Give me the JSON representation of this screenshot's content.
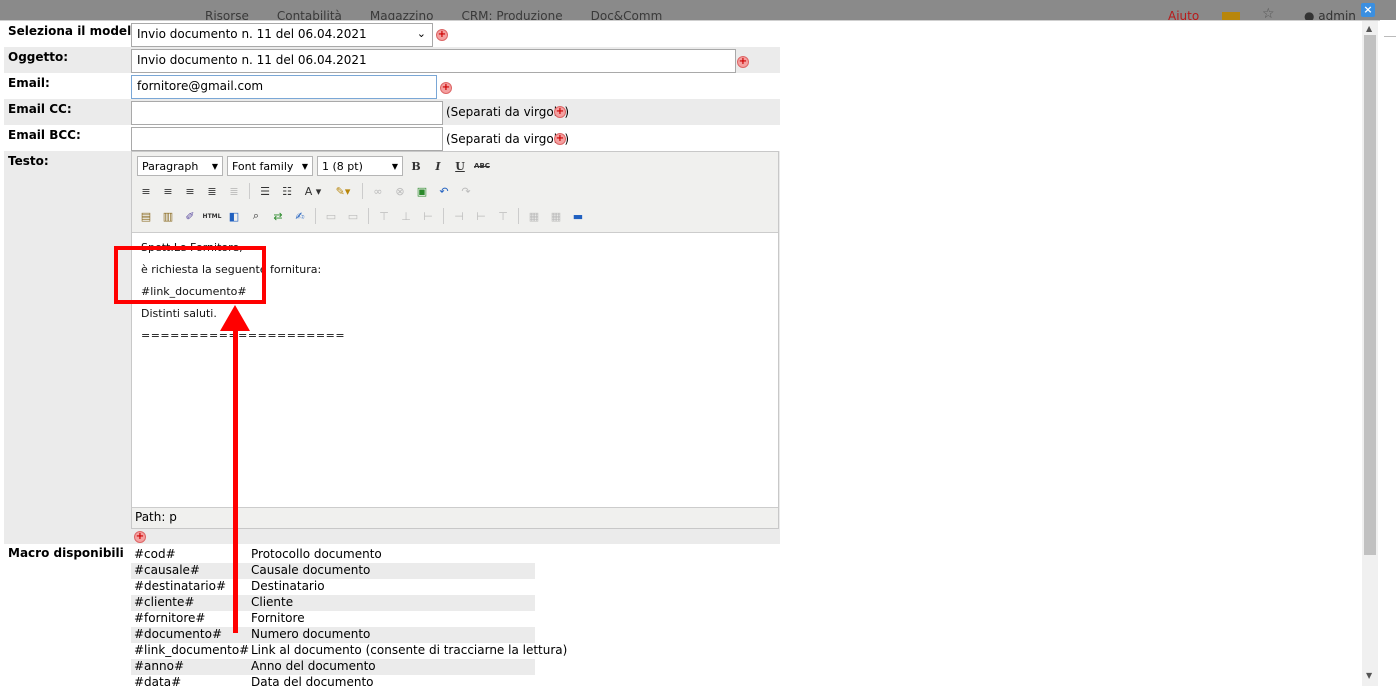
{
  "app_nav": {
    "items": [
      "Risorse",
      "Contabilità",
      "Magazzino",
      "CRM: Produzione",
      "Doc&Comm"
    ],
    "help": "Aiuto",
    "user": "admin"
  },
  "dialog": {
    "close_icon": "close-icon"
  },
  "form": {
    "model_label": "Seleziona il modello:",
    "model_value": "Invio documento n. 11 del 06.04.2021",
    "subject_label": "Oggetto:",
    "subject_value": "Invio documento n. 11 del 06.04.2021",
    "email_label": "Email:",
    "email_value": "fornitore@gmail.com",
    "cc_label": "Email CC:",
    "cc_value": "",
    "cc_note": "(Separati da virgola)",
    "bcc_label": "Email BCC:",
    "bcc_value": "",
    "bcc_note": "(Separati da virgola)",
    "text_label": "Testo:"
  },
  "editor": {
    "format_select": "Paragraph",
    "font_family_select": "Font family",
    "font_size_select": "1 (8 pt)",
    "body_lines": [
      "Spett.Le Fornitore,",
      "è richiesta la seguente fornitura:",
      "#link_documento#",
      "Distinti saluti.",
      "=====================",
      ""
    ],
    "path_label": "Path: p"
  },
  "macros": {
    "label": "Macro disponibili",
    "rows": [
      {
        "key": "#cod#",
        "desc": "Protocollo documento"
      },
      {
        "key": "#causale#",
        "desc": "Causale documento"
      },
      {
        "key": "#destinatario#",
        "desc": "Destinatario"
      },
      {
        "key": "#cliente#",
        "desc": "Cliente"
      },
      {
        "key": "#fornitore#",
        "desc": "Fornitore"
      },
      {
        "key": "#documento#",
        "desc": "Numero documento"
      },
      {
        "key": "#link_documento#",
        "desc": "Link al documento (consente di tracciarne la lettura)"
      },
      {
        "key": "#anno#",
        "desc": "Anno del documento"
      },
      {
        "key": "#data#",
        "desc": "Data del documento"
      }
    ]
  },
  "colors": {
    "annotation": "#ff0000",
    "row_shade": "#ebebeb",
    "accent_blue": "#3b8fe0"
  }
}
